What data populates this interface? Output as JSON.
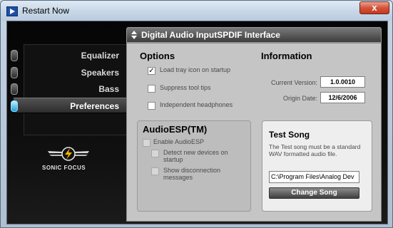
{
  "window": {
    "title": "Restart Now",
    "close_label": "x"
  },
  "header": {
    "title": "Digital Audio InputSPDIF Interface"
  },
  "sidebar": {
    "items": [
      {
        "label": "Equalizer"
      },
      {
        "label": "Speakers"
      },
      {
        "label": "Bass"
      },
      {
        "label": "Preferences"
      }
    ],
    "active": "Preferences"
  },
  "logo": {
    "text": "SONIC FOCUS"
  },
  "options": {
    "title": "Options",
    "checkboxes": [
      {
        "label": "Load tray icon on startup",
        "checked": true
      },
      {
        "label": "Suppress tool tips",
        "checked": false
      },
      {
        "label": "Independent headphones",
        "checked": false
      }
    ]
  },
  "information": {
    "title": "Information",
    "version_label": "Current Version:",
    "version_value": "1.0.0010",
    "origin_label": "Origin Date:",
    "origin_value": "12/6/2006"
  },
  "audioesp": {
    "title": "AudioESP(TM)",
    "enable_label": "Enable AudioESP",
    "detect_label": "Detect new devices on startup",
    "show_label": "Show disconnection messages"
  },
  "test_song": {
    "title": "Test Song",
    "description": "The Test song must be a standard WAV formatted audio file.",
    "path_value": "C:\\Program Files\\Analog Dev",
    "button_label": "Change Song"
  }
}
